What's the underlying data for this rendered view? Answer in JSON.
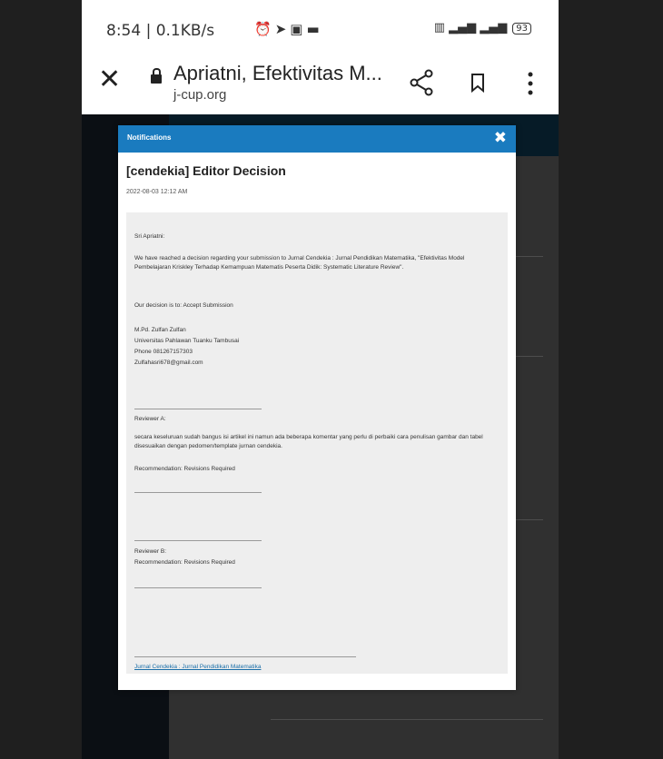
{
  "status_bar": {
    "time_speed": "8:54 | 0.1KB/s",
    "battery": "93"
  },
  "browser": {
    "page_title": "Apriatni, Efektivitas M...",
    "domain": "j-cup.org"
  },
  "modal": {
    "header_title": "Notifications",
    "close_label": "✖",
    "title": "[cendekia] Editor Decision",
    "date": "2022-08-03 12:12 AM",
    "message": {
      "greeting": "Sri Apriatni:",
      "intro": "We have reached a decision regarding your submission to Jurnal Cendekia : Jurnal Pendidikan Matematika, \"Efektivitas Model Pembelajaran Kriskley Terhadap Kemampuan Matematis Peserta Didik: Systematic Literature Review\".",
      "decision": "Our decision is to: Accept Submission",
      "signature": [
        "M.Pd. Zulfan Zulfan",
        "Universitas Pahlawan Tuanku Tambusai",
        "Phone 081267157303",
        "Zulfahasri678@gmail.com"
      ],
      "reviewer_a_label": "Reviewer A:",
      "reviewer_a_comment": "secara keseluruan sudah bangus isi artikel ini namun ada beberapa komentar yang perlu di perbaiki cara penulisan gambar dan tabel disesuaikan dengan pedomen/template jurnan cendekia.",
      "reviewer_a_rec": "Recommendation: Revisions Required",
      "reviewer_b_label": "Reviewer B:",
      "reviewer_b_rec": "Recommendation: Revisions Required",
      "footer_link": "Jurnal Cendekia : Jurnal Pendidikan Matematika"
    }
  }
}
